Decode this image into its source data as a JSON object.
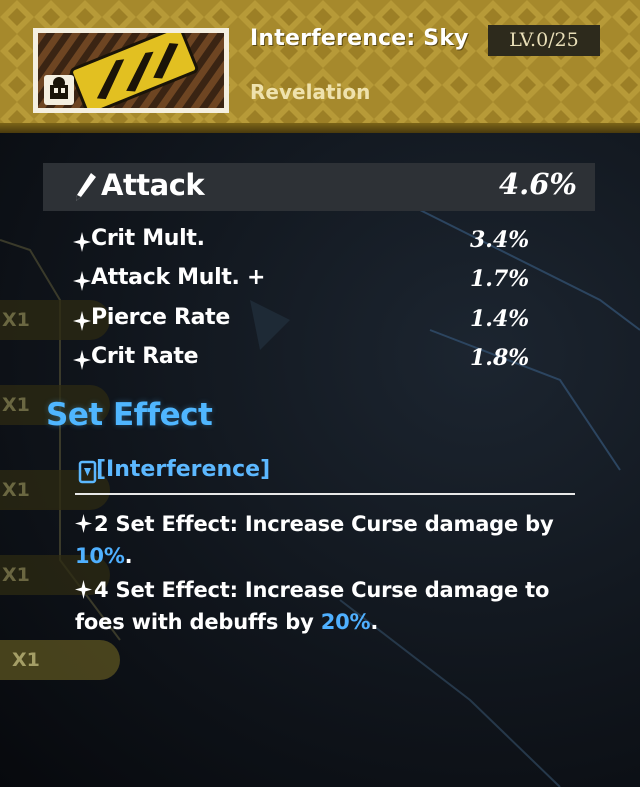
{
  "item": {
    "name": "Interference: Sky",
    "level": "LV.0/25",
    "category": "Revelation"
  },
  "main_stat": {
    "label": "Attack",
    "value": "4.6%",
    "icon": "attack-pen-icon"
  },
  "sub_stats": [
    {
      "label": "Crit Mult.",
      "value": "3.4%"
    },
    {
      "label": "Attack Mult. +",
      "value": "1.7%"
    },
    {
      "label": "Pierce Rate",
      "value": "1.4%"
    },
    {
      "label": "Crit Rate",
      "value": "1.8%"
    }
  ],
  "set_effect": {
    "title": "Set Effect",
    "name": "[Interference]",
    "effects": [
      {
        "prefix": "2 Set Effect: Increase Curse damage by ",
        "highlight": "10%",
        "suffix": "."
      },
      {
        "prefix": "4 Set Effect: Increase Curse damage to foes with debuffs by ",
        "highlight": "20%",
        "suffix": "."
      }
    ]
  },
  "side_tabs": [
    "X1",
    "X1",
    "X1",
    "X1",
    "X1"
  ],
  "colors": {
    "header_gold": "#a6892c",
    "accent_blue": "#4fb6ff",
    "stat_bar": "#2d3136",
    "level_badge": "#2d2a1c"
  }
}
